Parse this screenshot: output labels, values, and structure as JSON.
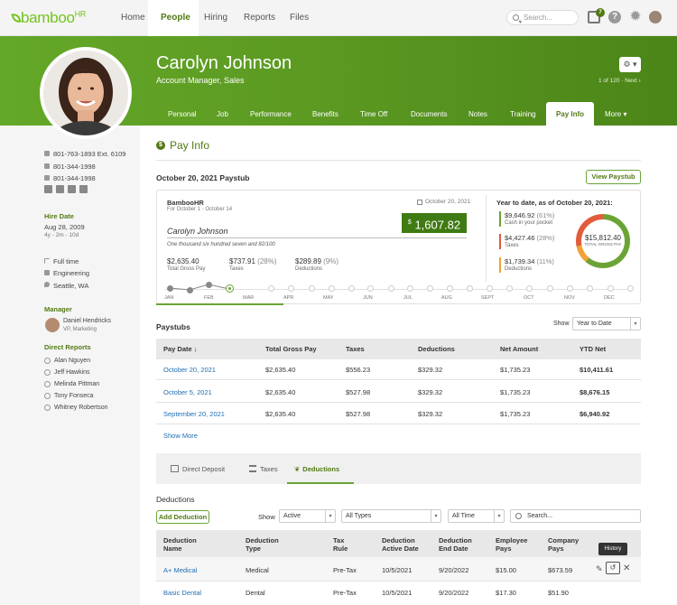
{
  "topnav": {
    "logo": "bamboo",
    "logo_hr": "HR",
    "links": [
      "Home",
      "People",
      "Hiring",
      "Reports",
      "Files"
    ],
    "active": "People",
    "search_placeholder": "Search...",
    "inbox_badge": "7",
    "help": "?"
  },
  "profile": {
    "name": "Carolyn Johnson",
    "title": "Account Manager, Sales",
    "pager": "1 of 120 · Next ›",
    "settings_label": "⚙ ▾"
  },
  "tabs": [
    "Personal",
    "Job",
    "Performance",
    "Benefits",
    "Time Off",
    "Documents",
    "Notes",
    "Training",
    "Pay Info",
    "More ▾"
  ],
  "active_tab": "Pay Info",
  "left": {
    "phone_work": "801-763-1893  Ext. 6109",
    "phone_mobile": "801-344-1998",
    "phone_home": "801-344-1998",
    "hire_date_label": "Hire Date",
    "hire_date": "Aug 28, 2009",
    "tenure": "4y - 2m - 10d",
    "employment": "Full time",
    "department": "Engineering",
    "location": "Seattle, WA",
    "manager_label": "Manager",
    "manager_name": "Daniel Hendricks",
    "manager_title": "VP, Marketing",
    "direct_reports_label": "Direct Reports",
    "direct_reports": [
      "Alan Nguyen",
      "Jeff Hawkins",
      "Melinda Pittman",
      "Tony Fonseca",
      "Whitney Robertson"
    ]
  },
  "payinfo": {
    "title": "Pay Info",
    "icon": "$",
    "paystub_title": "October 20, 2021 Paystub",
    "view_paystub": "View Paystub",
    "company": "BambooHR",
    "period": "For October 1 - October 14",
    "date": "October 20, 2021",
    "payee": "Carolyn Johnson",
    "amount_words": "One thousand six hundred seven and 82/100",
    "net_symbol": "$",
    "net_amount": "1,607.82",
    "gross": "$2,635.40",
    "gross_label": "Total Gross Pay",
    "taxes": "$737.91",
    "taxes_pct": "(28%)",
    "taxes_label": "Taxes",
    "deductions": "$289.89",
    "deductions_pct": "(9%)",
    "deductions_label": "Deductions",
    "months": [
      "JAN",
      "FEB",
      "MAR",
      "APR",
      "MAY",
      "JUN",
      "JUL",
      "AUG",
      "SEPT",
      "OCT",
      "NOV",
      "DEC"
    ],
    "ytd_title": "Year to date, as of October 20, 2021:",
    "ytd": [
      {
        "amount": "$9,646.92",
        "pct": "(61%)",
        "label": "Cash in your pocket",
        "color": "#6aa435"
      },
      {
        "amount": "$4,427.46",
        "pct": "(28%)",
        "label": "Taxes",
        "color": "#e15b3c"
      },
      {
        "amount": "$1,739.34",
        "pct": "(11%)",
        "label": "Deductions",
        "color": "#f0a236"
      }
    ],
    "ytd_total": "$15,812.40",
    "ytd_total_label": "TOTAL GROSS PAY"
  },
  "paystubs": {
    "title": "Paystubs",
    "show_label": "Show",
    "show_value": "Year to Date",
    "headers": [
      "Pay Date ↓",
      "Total Gross Pay",
      "Taxes",
      "Deductions",
      "Net Amount",
      "YTD Net"
    ],
    "rows": [
      [
        "October 20, 2021",
        "$2,635.40",
        "$556.23",
        "$329.32",
        "$1,735.23",
        "$10,411.61"
      ],
      [
        "October 5, 2021",
        "$2,635.40",
        "$527.98",
        "$329.32",
        "$1,735.23",
        "$8,676.15"
      ],
      [
        "September 20, 2021",
        "$2,635.40",
        "$527.98",
        "$329.32",
        "$1,735.23",
        "$6,940.92"
      ]
    ],
    "show_more": "Show More"
  },
  "subtabs": [
    "Direct Deposit",
    "Taxes",
    "Deductions"
  ],
  "active_subtab": "Deductions",
  "deductions": {
    "title": "Deductions",
    "add_button": "Add Deduction",
    "show_label": "Show",
    "filter_status": "Active",
    "filter_type": "All Types",
    "filter_time": "All Time",
    "search_placeholder": "Search...",
    "headers": [
      [
        "Deduction",
        "Name"
      ],
      [
        "Deduction",
        "Type"
      ],
      [
        "Tax",
        "Rule"
      ],
      [
        "Deduction",
        "Active Date"
      ],
      [
        "Deduction",
        "End Date"
      ],
      [
        "Employee",
        "Pays"
      ],
      [
        "Company",
        "Pays"
      ]
    ],
    "rows": [
      [
        "A+ Medical",
        "Medical",
        "Pre-Tax",
        "10/5/2021",
        "9/20/2022",
        "$15.00",
        "$673.59"
      ],
      [
        "Basic Dental",
        "Dental",
        "Pre-Tax",
        "10/5/2021",
        "9/20/2022",
        "$17.30",
        "$51.90"
      ]
    ],
    "tooltip": "History"
  }
}
